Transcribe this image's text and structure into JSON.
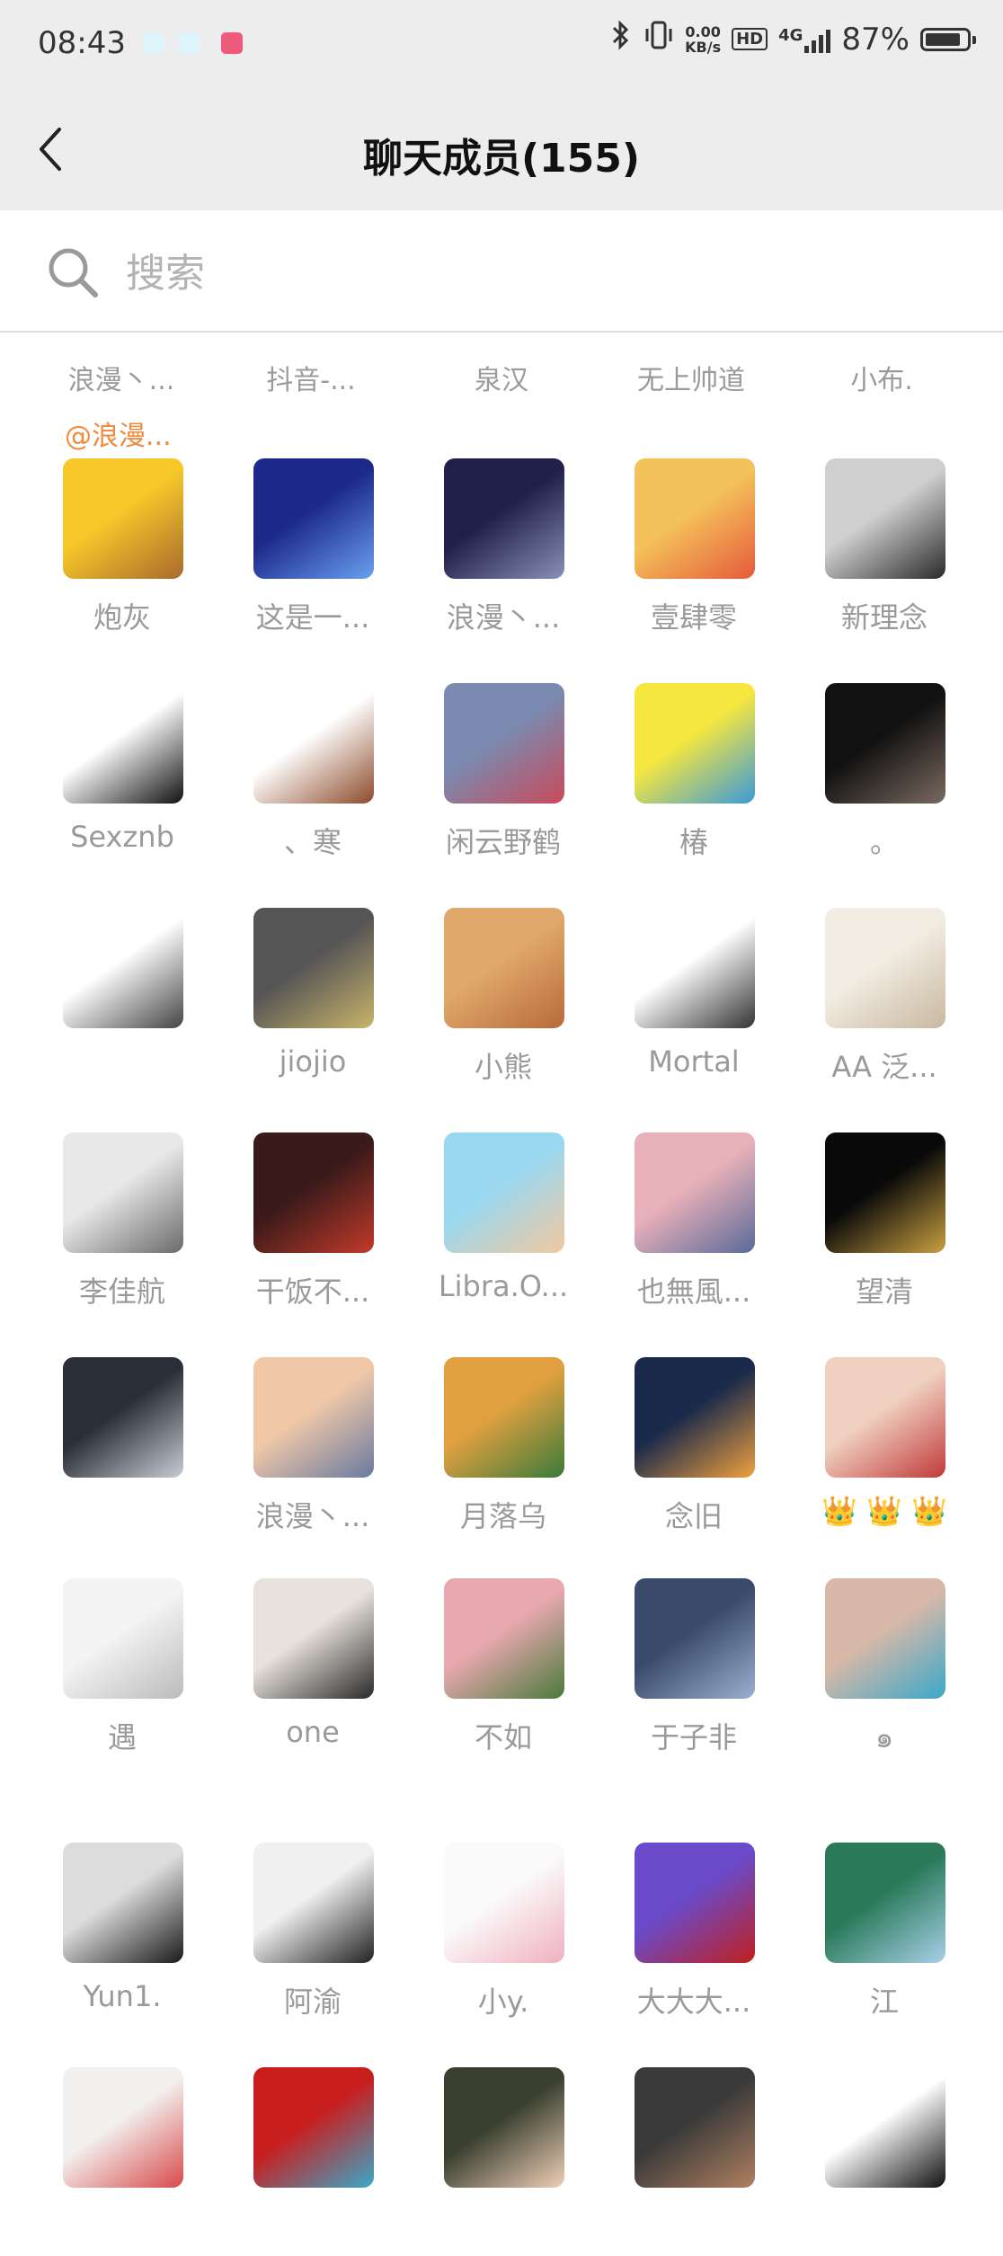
{
  "status_bar": {
    "time": "08:43",
    "network_speed_value": "0.00",
    "network_speed_unit": "KB/s",
    "hd": "HD",
    "network_type": "4G",
    "battery": "87%",
    "battery_level": 0.87
  },
  "header": {
    "title": "聊天成员(155)"
  },
  "search": {
    "placeholder": "搜索"
  },
  "top_row": {
    "names": [
      "浪漫丶...",
      "抖音-...",
      "泉汉",
      "无上帅道",
      "小布."
    ],
    "mention": "@浪漫..."
  },
  "members": [
    {
      "name": "炮灰",
      "colors": [
        "#f7c82a",
        "#a86a2c"
      ]
    },
    {
      "name": "这是一...",
      "colors": [
        "#1d2a8c",
        "#6aa0f0"
      ]
    },
    {
      "name": "浪漫丶...",
      "colors": [
        "#20204a",
        "#8a90b8"
      ]
    },
    {
      "name": "壹肆零",
      "colors": [
        "#f4c25a",
        "#e65a3c"
      ]
    },
    {
      "name": "新理念",
      "colors": [
        "#cfcfcf",
        "#2a2a2a"
      ]
    },
    {
      "name": "Sexznb",
      "colors": [
        "#ffffff",
        "#111111"
      ]
    },
    {
      "name": "、寒",
      "colors": [
        "#ffffff",
        "#8c4a2a"
      ]
    },
    {
      "name": "闲云野鹤",
      "colors": [
        "#7a8ab0",
        "#c94a5a"
      ]
    },
    {
      "name": "椿",
      "colors": [
        "#f5e640",
        "#3a9ad8"
      ]
    },
    {
      "name": "。",
      "colors": [
        "#111111",
        "#7a6a60"
      ]
    },
    {
      "name": "",
      "colors": [
        "#ffffff",
        "#444444"
      ]
    },
    {
      "name": "jiojio",
      "colors": [
        "#555555",
        "#c9b46a"
      ]
    },
    {
      "name": "小熊",
      "colors": [
        "#e0a86a",
        "#b86a3a"
      ]
    },
    {
      "name": "Mortal",
      "colors": [
        "#ffffff",
        "#333333"
      ]
    },
    {
      "name": "AA 泛...",
      "colors": [
        "#f2ece2",
        "#c8b8a0"
      ]
    },
    {
      "name": "李佳航",
      "colors": [
        "#e8e8e8",
        "#6a6a6a"
      ]
    },
    {
      "name": "干饭不...",
      "colors": [
        "#3a1a1a",
        "#c23a2a"
      ]
    },
    {
      "name": "Libra.O...",
      "colors": [
        "#9ad8f0",
        "#f2c8a0"
      ]
    },
    {
      "name": "也無風...",
      "colors": [
        "#e8b0b8",
        "#5a6a9a"
      ]
    },
    {
      "name": "望清",
      "colors": [
        "#0a0a0a",
        "#c9a040"
      ]
    },
    {
      "name": "",
      "colors": [
        "#2a2e36",
        "#c8ccd4"
      ]
    },
    {
      "name": "浪漫丶...",
      "colors": [
        "#f0c8a8",
        "#6a7aa0"
      ]
    },
    {
      "name": "月落乌",
      "colors": [
        "#e0a040",
        "#3a7a3a"
      ]
    },
    {
      "name": "念旧",
      "colors": [
        "#1a2a4a",
        "#f0a040"
      ]
    },
    {
      "name": "👑 👑 👑",
      "colors": [
        "#f0d0c0",
        "#c03a3a"
      ]
    },
    {
      "name": "遇",
      "colors": [
        "#f4f4f4",
        "#bbbbbb"
      ]
    },
    {
      "name": "one",
      "colors": [
        "#e8e2dc",
        "#2a2a2a"
      ]
    },
    {
      "name": "不如",
      "colors": [
        "#e8a8b0",
        "#4a7a3a"
      ]
    },
    {
      "name": "于子非",
      "colors": [
        "#3a4a6a",
        "#9ab0d0"
      ]
    },
    {
      "name": "๑",
      "colors": [
        "#d8b8a8",
        "#3aa8c8"
      ]
    },
    {
      "name": "Yun1.",
      "colors": [
        "#dcdcdc",
        "#1a1a1a"
      ]
    },
    {
      "name": "阿渝",
      "colors": [
        "#f0f0f0",
        "#222222"
      ]
    },
    {
      "name": "小y.",
      "colors": [
        "#fafafa",
        "#f0b0c0"
      ]
    },
    {
      "name": "大大大...",
      "colors": [
        "#6a4ac8",
        "#c02020"
      ]
    },
    {
      "name": "江",
      "colors": [
        "#2a7a5a",
        "#a8d0e8"
      ]
    },
    {
      "name": "",
      "colors": [
        "#f2f0ee",
        "#d84a4a"
      ]
    },
    {
      "name": "",
      "colors": [
        "#c81e1e",
        "#3aa8c8"
      ]
    },
    {
      "name": "",
      "colors": [
        "#3a4030",
        "#f0d0b8"
      ]
    },
    {
      "name": "",
      "colors": [
        "#3a3a3a",
        "#b08060"
      ]
    },
    {
      "name": "",
      "colors": [
        "#ffffff",
        "#111111"
      ]
    }
  ]
}
